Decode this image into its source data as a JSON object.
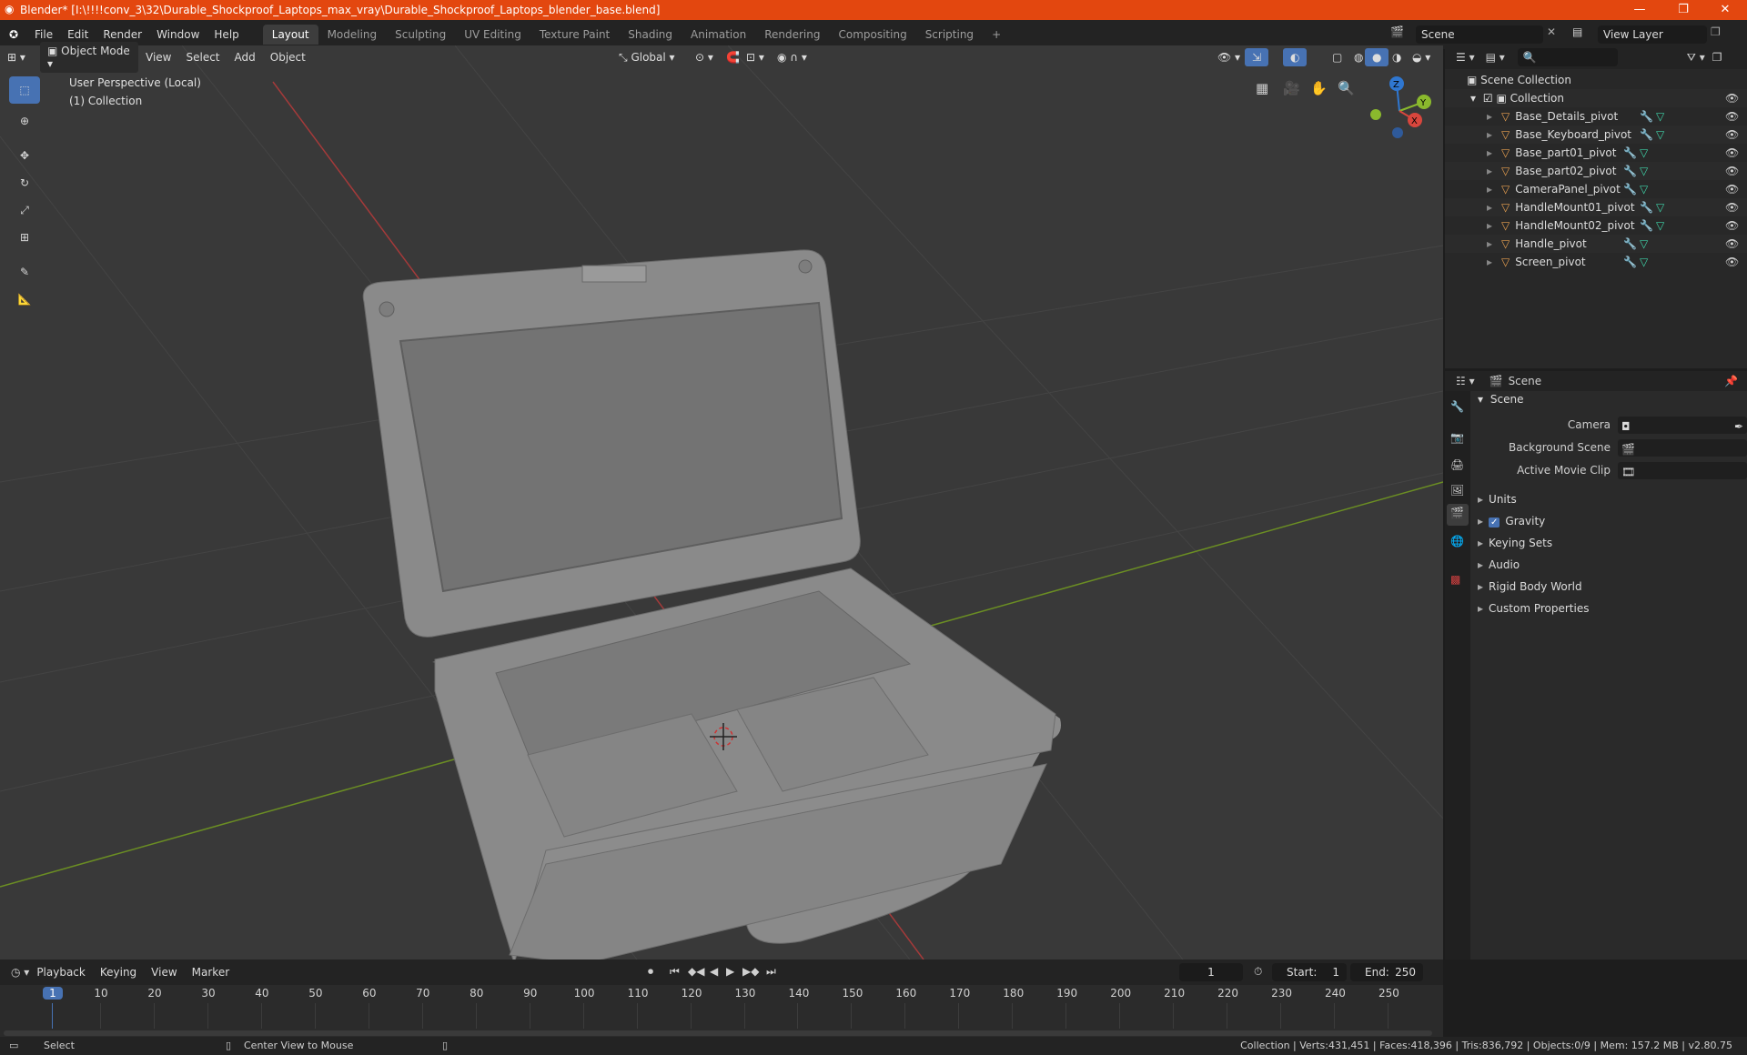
{
  "window": {
    "title": "Blender* [I:\\!!!!conv_3\\32\\Durable_Shockproof_Laptops_max_vray\\Durable_Shockproof_Laptops_blender_base.blend]",
    "accent": "#e3470f"
  },
  "menu": [
    "File",
    "Edit",
    "Render",
    "Window",
    "Help"
  ],
  "workspaces": [
    "Layout",
    "Modeling",
    "Sculpting",
    "UV Editing",
    "Texture Paint",
    "Shading",
    "Animation",
    "Rendering",
    "Compositing",
    "Scripting"
  ],
  "active_workspace": "Layout",
  "scene_field": "Scene",
  "view_layer_field": "View Layer",
  "viewport": {
    "mode": "Object Mode",
    "menus": [
      "View",
      "Select",
      "Add",
      "Object"
    ],
    "transform": "Global",
    "overlay_text_1": "User Perspective (Local)",
    "overlay_text_2": "(1) Collection",
    "gizmo": {
      "z": "Z",
      "y": "Y",
      "x": "X"
    }
  },
  "outliner": {
    "root": "Scene Collection",
    "collection": "Collection",
    "items": [
      "Base_Details_pivot",
      "Base_Keyboard_pivot",
      "Base_part01_pivot",
      "Base_part02_pivot",
      "CameraPanel_pivot",
      "HandleMount01_pivot",
      "HandleMount02_pivot",
      "Handle_pivot",
      "Screen_pivot"
    ]
  },
  "properties": {
    "context": "Scene",
    "panel": "Scene",
    "fields": {
      "camera": "Camera",
      "background_scene": "Background Scene",
      "active_movie_clip": "Active Movie Clip"
    },
    "subpanels": [
      "Units",
      "Gravity",
      "Keying Sets",
      "Audio",
      "Rigid Body World",
      "Custom Properties"
    ]
  },
  "timeline": {
    "menus": [
      "Playback",
      "Keying",
      "View",
      "Marker"
    ],
    "current_frame": "1",
    "start_label": "Start:",
    "start": "1",
    "end_label": "End:",
    "end": "250",
    "ticks": [
      "1",
      "10",
      "20",
      "30",
      "40",
      "50",
      "60",
      "70",
      "80",
      "90",
      "100",
      "110",
      "120",
      "130",
      "140",
      "150",
      "160",
      "170",
      "180",
      "190",
      "200",
      "210",
      "220",
      "230",
      "240",
      "250"
    ]
  },
  "status": {
    "left": "Select",
    "middle": "Center View to Mouse",
    "right": "Collection | Verts:431,451 | Faces:418,396 | Tris:836,792 | Objects:0/9 | Mem: 157.2 MB | v2.80.75"
  }
}
